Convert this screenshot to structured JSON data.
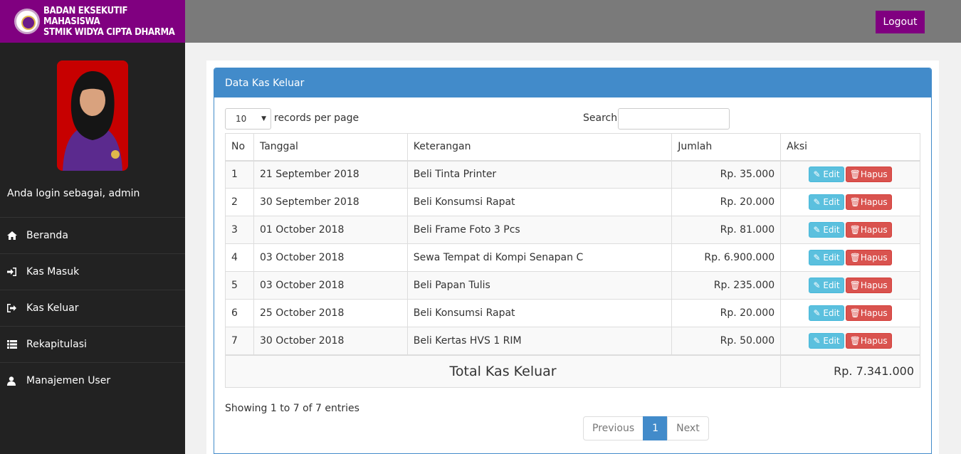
{
  "brand": {
    "line1": "BADAN EKSEKUTIF MAHASISWA",
    "line2": "STMIK WIDYA CIPTA DHARMA"
  },
  "header": {
    "logout_label": "Logout"
  },
  "sidebar": {
    "login_text": "Anda login sebagai, admin",
    "items": [
      {
        "label": "Beranda",
        "icon": "home-icon"
      },
      {
        "label": "Kas Masuk",
        "icon": "sign-in-icon"
      },
      {
        "label": "Kas Keluar",
        "icon": "sign-out-icon"
      },
      {
        "label": "Rekapitulasi",
        "icon": "list-icon"
      },
      {
        "label": "Manajemen User",
        "icon": "user-icon"
      }
    ]
  },
  "panel": {
    "title": "Data Kas Keluar"
  },
  "controls": {
    "page_length": "10",
    "page_length_label": "records per page",
    "search_label": "Search:",
    "search_value": ""
  },
  "table": {
    "columns": [
      "No",
      "Tanggal",
      "Keterangan",
      "Jumlah",
      "Aksi"
    ],
    "rows": [
      {
        "no": "1",
        "tanggal": "21 September 2018",
        "keterangan": "Beli Tinta Printer",
        "jumlah": "Rp. 35.000"
      },
      {
        "no": "2",
        "tanggal": "30 September 2018",
        "keterangan": "Beli Konsumsi Rapat",
        "jumlah": "Rp. 20.000"
      },
      {
        "no": "3",
        "tanggal": "01 October 2018",
        "keterangan": "Beli Frame Foto 3 Pcs",
        "jumlah": "Rp. 81.000"
      },
      {
        "no": "4",
        "tanggal": "03 October 2018",
        "keterangan": "Sewa Tempat di Kompi Senapan C",
        "jumlah": "Rp. 6.900.000"
      },
      {
        "no": "5",
        "tanggal": "03 October 2018",
        "keterangan": "Beli Papan Tulis",
        "jumlah": "Rp. 235.000"
      },
      {
        "no": "6",
        "tanggal": "25 October 2018",
        "keterangan": "Beli Konsumsi Rapat",
        "jumlah": "Rp. 20.000"
      },
      {
        "no": "7",
        "tanggal": "30 October 2018",
        "keterangan": "Beli Kertas HVS 1 RIM",
        "jumlah": "Rp. 50.000"
      }
    ],
    "edit_label": "Edit",
    "delete_label": "Hapus",
    "total_label": "Total Kas Keluar",
    "total_value": "Rp. 7.341.000"
  },
  "footer": {
    "info": "Showing 1 to 7 of 7 entries",
    "prev_label": "Previous",
    "current_page": "1",
    "next_label": "Next"
  },
  "colors": {
    "brand": "#800080",
    "panel": "#428bca",
    "edit": "#5bc0de",
    "delete": "#d9534f"
  }
}
